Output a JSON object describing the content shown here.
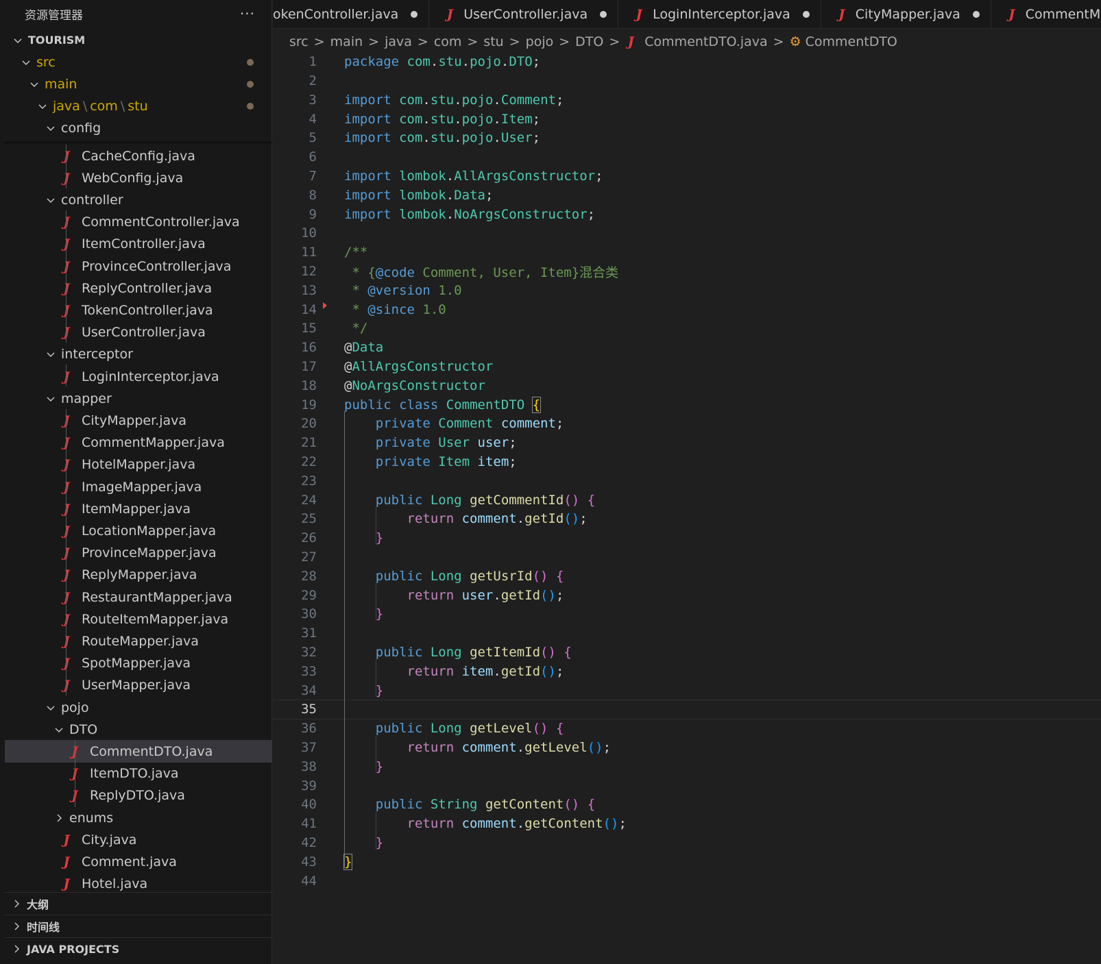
{
  "sidebar": {
    "title": "资源管理器",
    "more_icon": "···",
    "project": "TOURISM",
    "src": "src",
    "main": "main",
    "java_path": [
      "java",
      "com",
      "stu"
    ],
    "config": "config",
    "files_config": [
      "CacheConfig.java",
      "WebConfig.java"
    ],
    "controller": "controller",
    "files_controller": [
      "CommentController.java",
      "ItemController.java",
      "ProvinceController.java",
      "ReplyController.java",
      "TokenController.java",
      "UserController.java"
    ],
    "interceptor": "interceptor",
    "files_interceptor": [
      "LoginInterceptor.java"
    ],
    "mapper": "mapper",
    "files_mapper": [
      "CityMapper.java",
      "CommentMapper.java",
      "HotelMapper.java",
      "ImageMapper.java",
      "ItemMapper.java",
      "LocationMapper.java",
      "ProvinceMapper.java",
      "ReplyMapper.java",
      "RestaurantMapper.java",
      "RouteItemMapper.java",
      "RouteMapper.java",
      "SpotMapper.java",
      "UserMapper.java"
    ],
    "pojo": "pojo",
    "dto": "DTO",
    "files_dto": [
      "CommentDTO.java",
      "ItemDTO.java",
      "ReplyDTO.java"
    ],
    "enums": "enums",
    "files_pojo": [
      "City.java",
      "Comment.java",
      "Hotel.java"
    ],
    "sections": [
      "大纲",
      "时间线",
      "JAVA PROJECTS"
    ],
    "file_icon": "J"
  },
  "tabs": [
    {
      "label": "okenController.java",
      "icon": false
    },
    {
      "label": "UserController.java",
      "icon": true
    },
    {
      "label": "LoginInterceptor.java",
      "icon": true
    },
    {
      "label": "CityMapper.java",
      "icon": true
    },
    {
      "label": "CommentMapper.java",
      "icon": true
    }
  ],
  "breadcrumb": {
    "parts": [
      "src",
      "main",
      "java",
      "com",
      "stu",
      "pojo",
      "DTO"
    ],
    "file": "CommentDTO.java",
    "symbol": "CommentDTO",
    "separator": ">",
    "symbol_icon": "class-icon"
  },
  "editor": {
    "active_line": 35,
    "line_count": 44,
    "lines": [
      "package com.stu.pojo.DTO;",
      "",
      "import com.stu.pojo.Comment;",
      "import com.stu.pojo.Item;",
      "import com.stu.pojo.User;",
      "",
      "import lombok.AllArgsConstructor;",
      "import lombok.Data;",
      "import lombok.NoArgsConstructor;",
      "",
      "/**",
      " * {@code Comment, User, Item}混合类",
      " * @version 1.0",
      " * @since 1.0",
      " */",
      "@Data",
      "@AllArgsConstructor",
      "@NoArgsConstructor",
      "public class CommentDTO {",
      "    private Comment comment;",
      "    private User user;",
      "    private Item item;",
      "",
      "    public Long getCommentId() {",
      "        return comment.getId();",
      "    }",
      "",
      "    public Long getUsrId() {",
      "        return user.getId();",
      "    }",
      "",
      "    public Long getItemId() {",
      "        return item.getId();",
      "    }",
      "",
      "    public Long getLevel() {",
      "        return comment.getLevel();",
      "    }",
      "",
      "    public String getContent() {",
      "        return comment.getContent();",
      "    }",
      "}",
      ""
    ]
  },
  "colors": {
    "background": "#1f1f1f",
    "sidebar": "#181818",
    "selection": "#37373d",
    "java_icon": "#e8373c",
    "keyword": "#569cd6",
    "control": "#c586c0",
    "type": "#4ec9b0",
    "function": "#dcdcaa",
    "variable": "#9cdcfe",
    "comment": "#6a9955"
  }
}
